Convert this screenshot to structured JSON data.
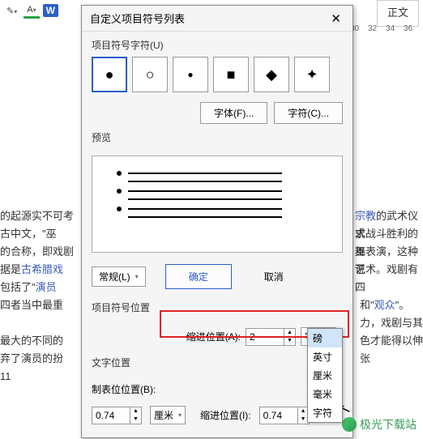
{
  "topbar": {
    "w_badge": "W"
  },
  "right_box": "正文",
  "ruler": {
    "m30": "30",
    "m32": "32",
    "m34": "34",
    "m36": "36"
  },
  "dialog": {
    "title": "自定义项目符号列表",
    "close": "✕",
    "bullet_chars_label": "项目符号字符(U)",
    "font_btn": "字体(F)...",
    "char_btn": "字符(C)...",
    "preview_label": "预览",
    "style_select": "常规(L)",
    "ok": "确定",
    "cancel": "取消",
    "bullet_pos_label": "项目符号位置",
    "indent_pos_label": "缩进位置(A):",
    "indent_pos_value": "2",
    "unit_label": "字符",
    "text_pos_label": "文字位置",
    "tab_pos_label": "制表位位置(B):",
    "tab_pos_value": "0.74",
    "tab_unit": "厘米",
    "indent2_label": "缩进位置(I):",
    "indent2_value": "0.74"
  },
  "unit_menu": [
    "磅",
    "英寸",
    "厘米",
    "毫米",
    "字符"
  ],
  "bg": {
    "l1a": "的起源实不可考",
    "l1b": "宗教",
    "l1c": "的武术仪式",
    "l2a": "古中文，\"巫",
    "l2b": "求战斗胜利的巫",
    "l3a": "的合称，即戏剧",
    "l3b": "舞表演，这种说",
    "l4a": "据是",
    "l4b": "古希腊戏",
    "l4c": "艺术。戏剧有四",
    "l5a": "包括了\"",
    "l5b": "演员",
    "l5c": "和\"",
    "l5d": "观众",
    "l5e": "\"。",
    "l6a": "四者当中最重",
    "l6b": "力，戏剧与其",
    "l7a": "最大的不同的",
    "l7b": "色才能得以伸张",
    "l8": "弃了演员的扮",
    "l9": "11"
  },
  "watermark": "极光下载站"
}
